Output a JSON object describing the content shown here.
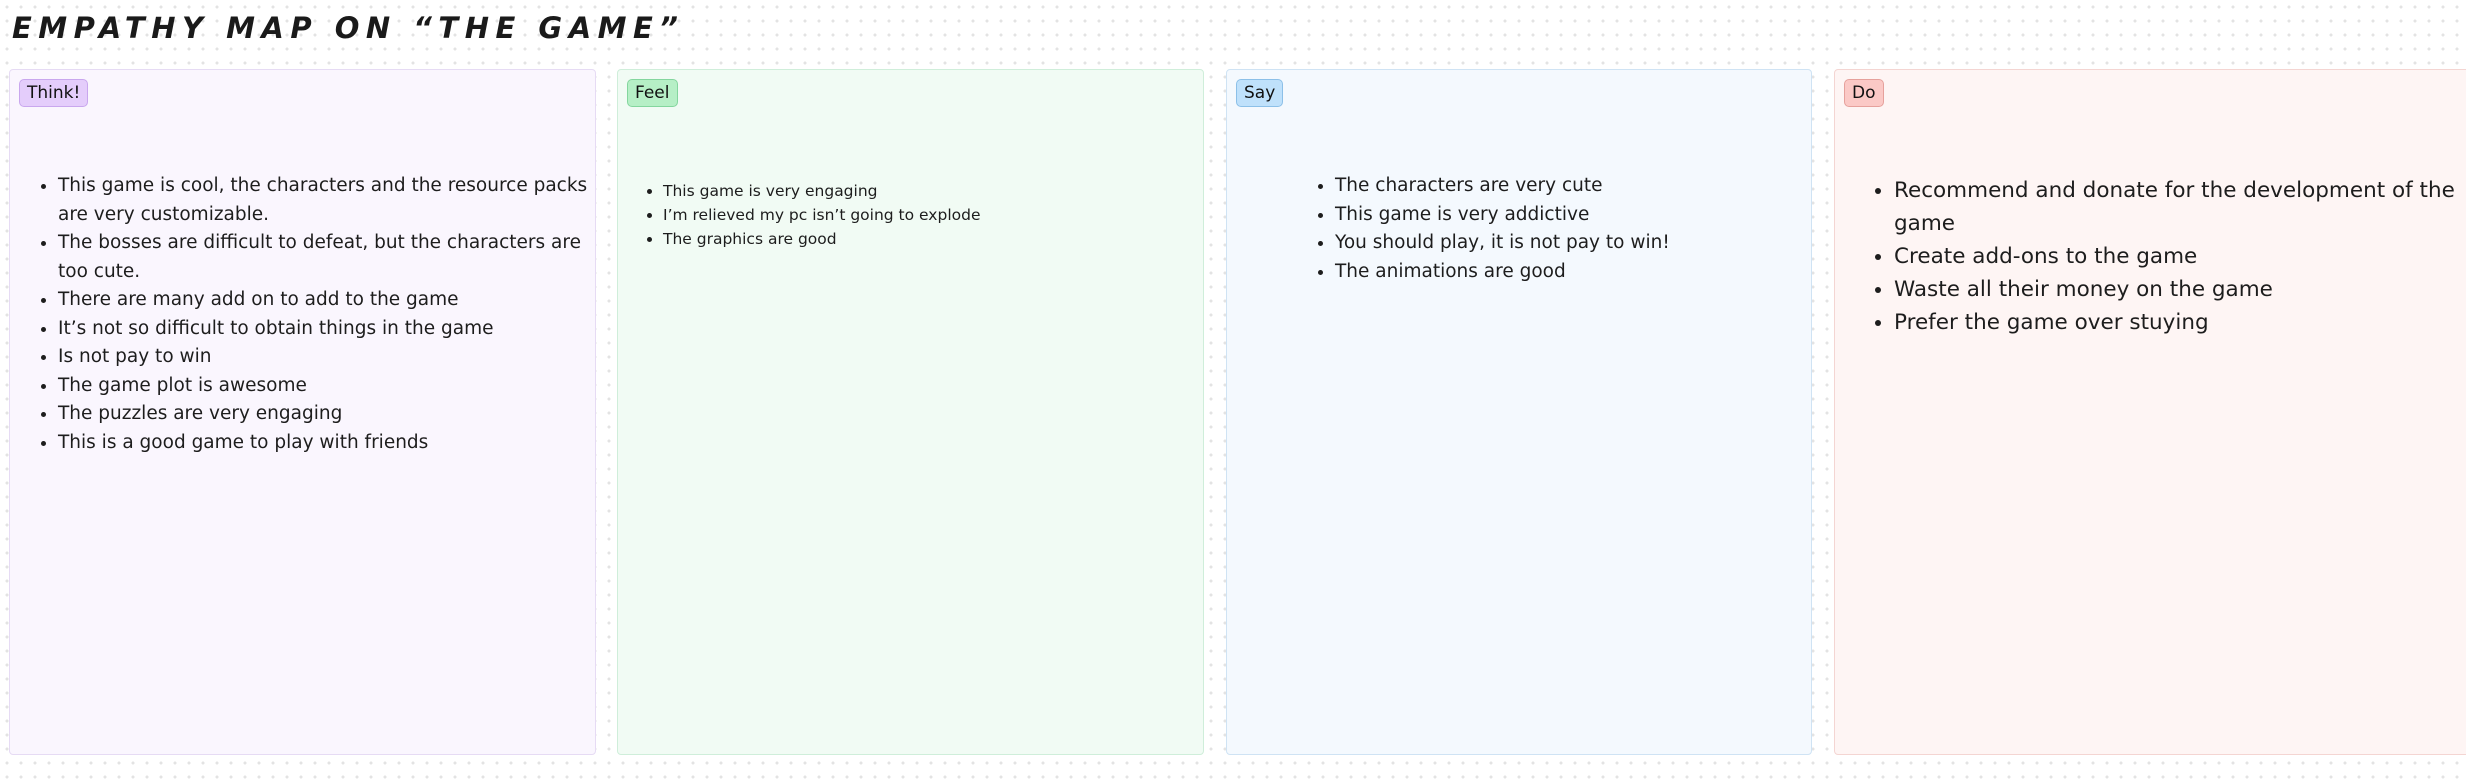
{
  "board": {
    "title": "EMPATHY MAP ON “THE GAME”"
  },
  "panels": {
    "think": {
      "label": "Think!",
      "accent": "#e4cdfb",
      "background": "#faf6fe",
      "notes": [
        "This game is cool, the characters and the resource packs are very customizable.",
        "The bosses are difficult to defeat, but the characters are too cute.",
        "There are many add on to add to the game",
        "It’s not so difficult to obtain things in the game",
        "Is not pay to win",
        "The game plot is awesome",
        "The puzzles are very engaging",
        "This is a good game to play with friends"
      ]
    },
    "feel": {
      "label": "Feel",
      "accent": "#b6efc6",
      "background": "#f1fbf4",
      "notes": [
        "This game is very engaging",
        "I’m relieved my pc isn’t going to explode",
        "The graphics are good"
      ]
    },
    "say": {
      "label": "Say",
      "accent": "#bfe1fb",
      "background": "#f4f9fe",
      "notes": [
        "The characters are very cute",
        "This game is very addictive",
        "You should play, it is not pay to win!",
        "The animations are good"
      ]
    },
    "do": {
      "label": "Do",
      "accent": "#fbc9c6",
      "background": "#fef5f4",
      "notes": [
        "Recommend and donate for the development of the game",
        "Create add-ons to the game",
        "Waste all their money on the game",
        "Prefer the game over stuying"
      ]
    }
  }
}
